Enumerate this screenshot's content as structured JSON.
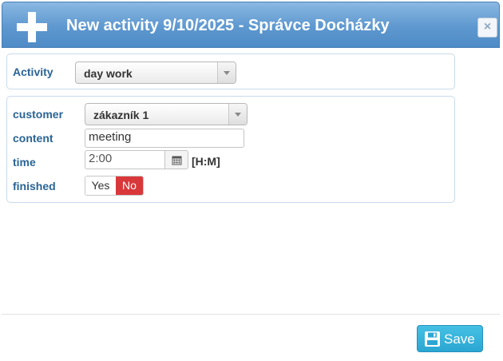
{
  "dialog": {
    "title": "New activity 9/10/2025 - Správce Docházky",
    "close_label": "×"
  },
  "activity": {
    "label": "Activity",
    "value": "day work"
  },
  "form": {
    "customer": {
      "label": "customer",
      "value": "zákazník 1"
    },
    "content": {
      "label": "content",
      "value": "meeting"
    },
    "time": {
      "label": "time",
      "value": "2:00",
      "unit_hint": "[H:M]"
    },
    "finished": {
      "label": "finished",
      "yes_label": "Yes",
      "no_label": "No",
      "selected": "No"
    }
  },
  "footer": {
    "save_label": "Save"
  },
  "colors": {
    "header_blue": "#5e98cf",
    "label_blue": "#2a6496",
    "no_active_red": "#d9383a",
    "save_button": "#2ba6d2"
  }
}
